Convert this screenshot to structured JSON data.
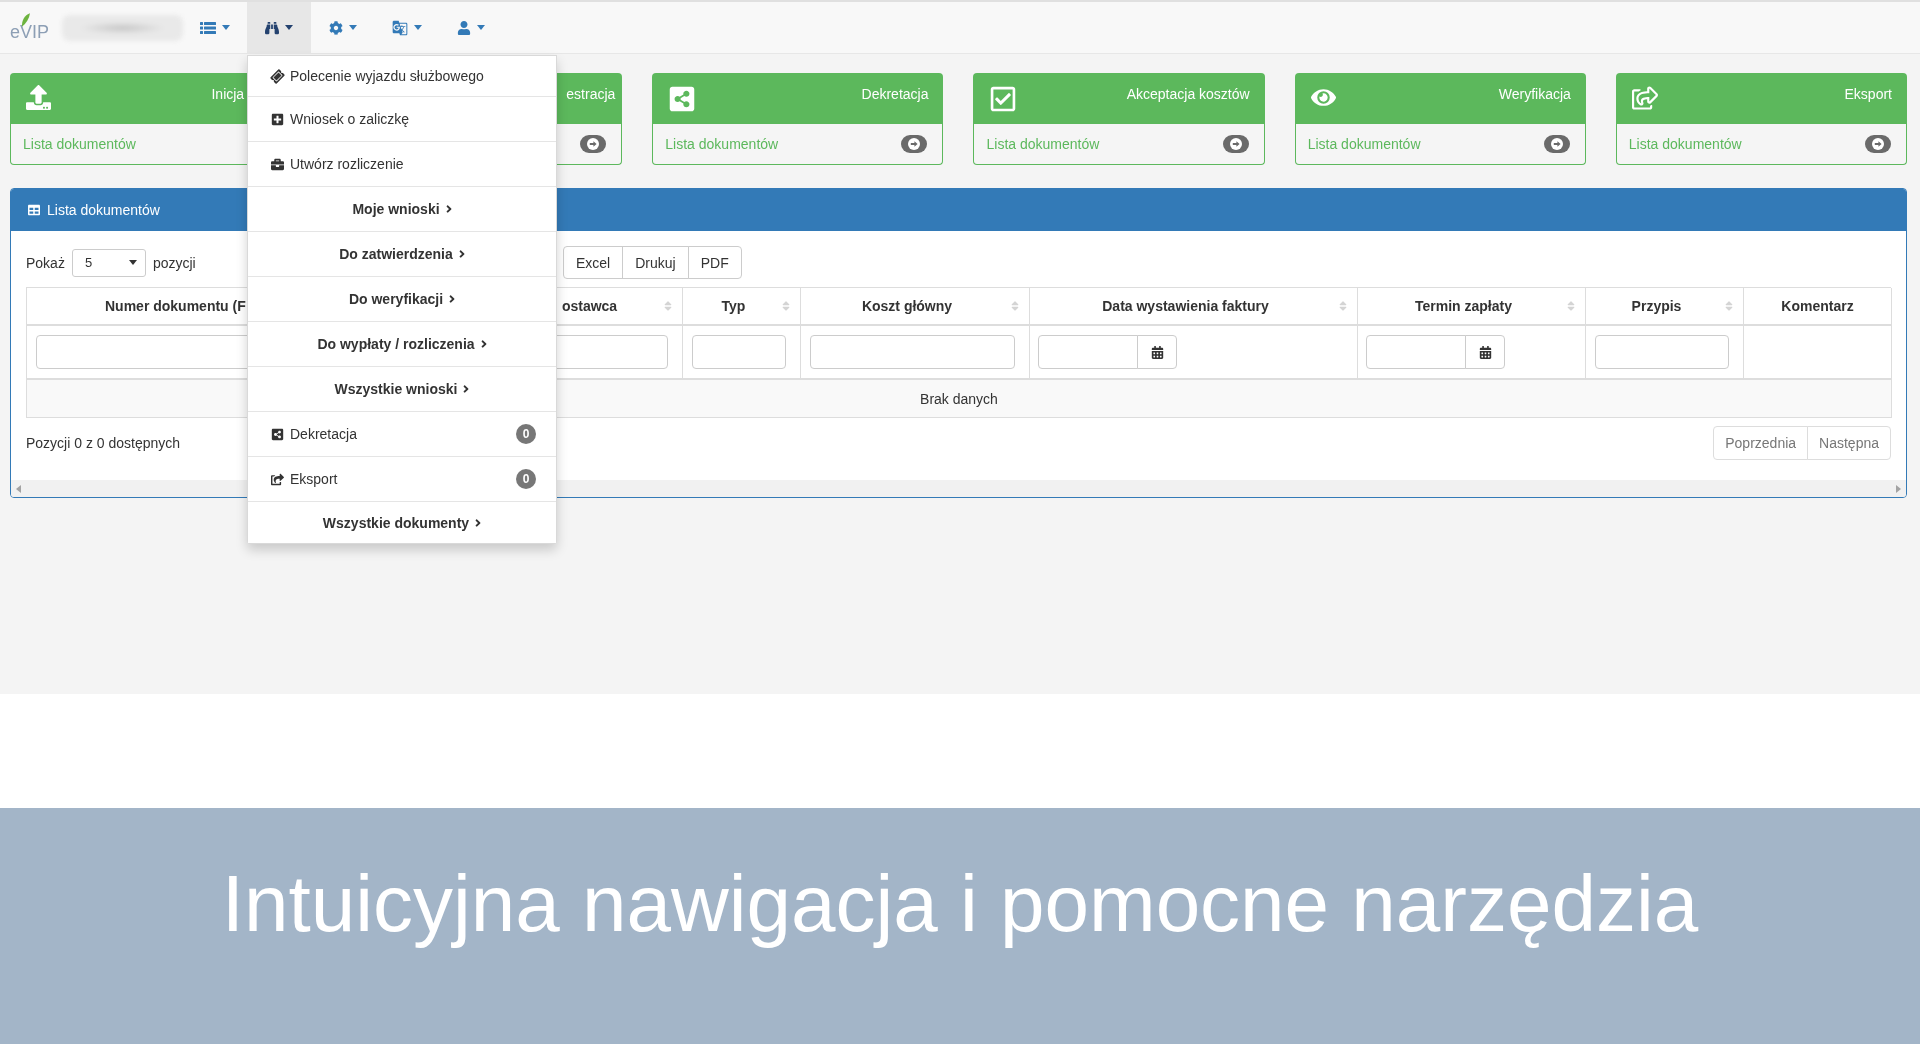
{
  "navbar": {
    "logo": "eVIP",
    "menus": [
      {
        "selected": false
      },
      {
        "selected": true,
        "items": [
          {
            "kind": "action",
            "label": "Polecenie wyjazdu służbowego"
          },
          {
            "kind": "action",
            "label": "Wniosek o zaliczkę"
          },
          {
            "kind": "action",
            "label": "Utwórz rozliczenie"
          },
          {
            "kind": "section",
            "label": "Moje wnioski"
          },
          {
            "kind": "section",
            "label": "Do zatwierdzenia"
          },
          {
            "kind": "section",
            "label": "Do weryfikacji"
          },
          {
            "kind": "section",
            "label": "Do wypłaty / rozliczenia"
          },
          {
            "kind": "section",
            "label": "Wszystkie wnioski"
          },
          {
            "kind": "counter",
            "label": "Dekretacja",
            "badge": "0"
          },
          {
            "kind": "counter",
            "label": "Eksport",
            "badge": "0"
          },
          {
            "kind": "section",
            "label": "Wszystkie dokumenty"
          }
        ]
      },
      {
        "selected": false
      },
      {
        "selected": false
      },
      {
        "selected": false
      }
    ]
  },
  "cards": [
    {
      "title": "Inicja",
      "link": "Lista dokumentów",
      "go_button": false
    },
    {
      "title": "estracja",
      "go_button": true
    },
    {
      "title": "Dekretacja",
      "link": "Lista dokumentów",
      "go_button": true
    },
    {
      "title": "Akceptacja kosztów",
      "link": "Lista dokumentów",
      "go_button": true
    },
    {
      "title": "Weryfikacja",
      "link": "Lista dokumentów",
      "go_button": true
    },
    {
      "title": "Eksport",
      "link": "Lista dokumentów",
      "go_button": true
    }
  ],
  "panel": {
    "title": "Lista dokumentów",
    "page_size": {
      "before": "Pokaż",
      "value": "5",
      "after": "pozycji"
    },
    "export_buttons": [
      "Excel",
      "Drukuj",
      "PDF"
    ],
    "table": {
      "columns": [
        {
          "label": "Numer dokumentu (F",
          "sortable": false
        },
        {
          "label": "ostawca",
          "sortable": true
        },
        {
          "label": "Typ",
          "sortable": true
        },
        {
          "label": "Koszt główny",
          "sortable": true
        },
        {
          "label": "Data wystawienia faktury",
          "sortable": true
        },
        {
          "label": "Termin zapłaty",
          "sortable": true
        },
        {
          "label": "Przypis",
          "sortable": true
        },
        {
          "label": "Komentarz",
          "sortable": false
        }
      ],
      "filters": [
        {
          "kind": "text"
        },
        {
          "kind": "text"
        },
        {
          "kind": "text"
        },
        {
          "kind": "text"
        },
        {
          "kind": "date"
        },
        {
          "kind": "date"
        },
        {
          "kind": "text"
        }
      ],
      "empty_message": "Brak danych"
    },
    "info": "Pozycji 0 z 0 dostępnych",
    "pagination": [
      {
        "label": "Poprzednia",
        "disabled": true
      },
      {
        "label": "Następna",
        "disabled": true
      }
    ]
  },
  "caption": "Intuicyjna nawigacja i pomocne narzędzia"
}
